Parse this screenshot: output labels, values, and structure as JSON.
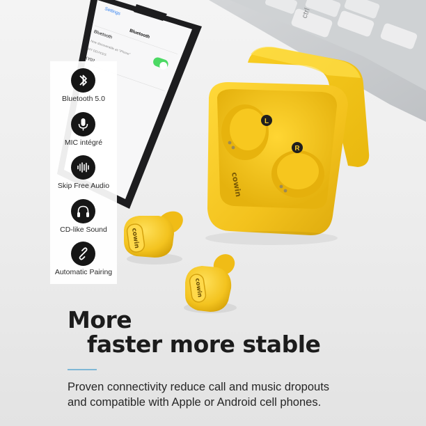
{
  "phone": {
    "back_label": "Settings",
    "screen_title": "Bluetooth",
    "bluetooth_label": "Bluetooth",
    "discoverable_text": "Now discoverable as \"iPhone\"",
    "section_header": "MY DEVICES",
    "device_name": "KY02",
    "toggle_on": true
  },
  "keyboard": {
    "key_label": "ctrl"
  },
  "case": {
    "brand": "cowin",
    "left_marker": "L",
    "right_marker": "R"
  },
  "earbuds": {
    "brand": "cowin"
  },
  "features": [
    {
      "icon": "bluetooth-icon",
      "label": "Bluetooth 5.0"
    },
    {
      "icon": "microphone-icon",
      "label": "MIC intégré"
    },
    {
      "icon": "sound-wave-icon",
      "label": "Skip Free Audio"
    },
    {
      "icon": "headphones-icon",
      "label": "CD-like Sound"
    },
    {
      "icon": "link-icon",
      "label": "Automatic Pairing"
    }
  ],
  "headline": {
    "line1": "More",
    "line2": "faster more stable"
  },
  "body": {
    "line1": "Proven connectivity reduce call and music dropouts",
    "line2": "and compatible with Apple or Android cell phones."
  },
  "colors": {
    "product_yellow": "#f5c826",
    "accent_rule": "#7fb7d6",
    "icon_bg": "#161616",
    "toggle_green": "#4cd964"
  }
}
